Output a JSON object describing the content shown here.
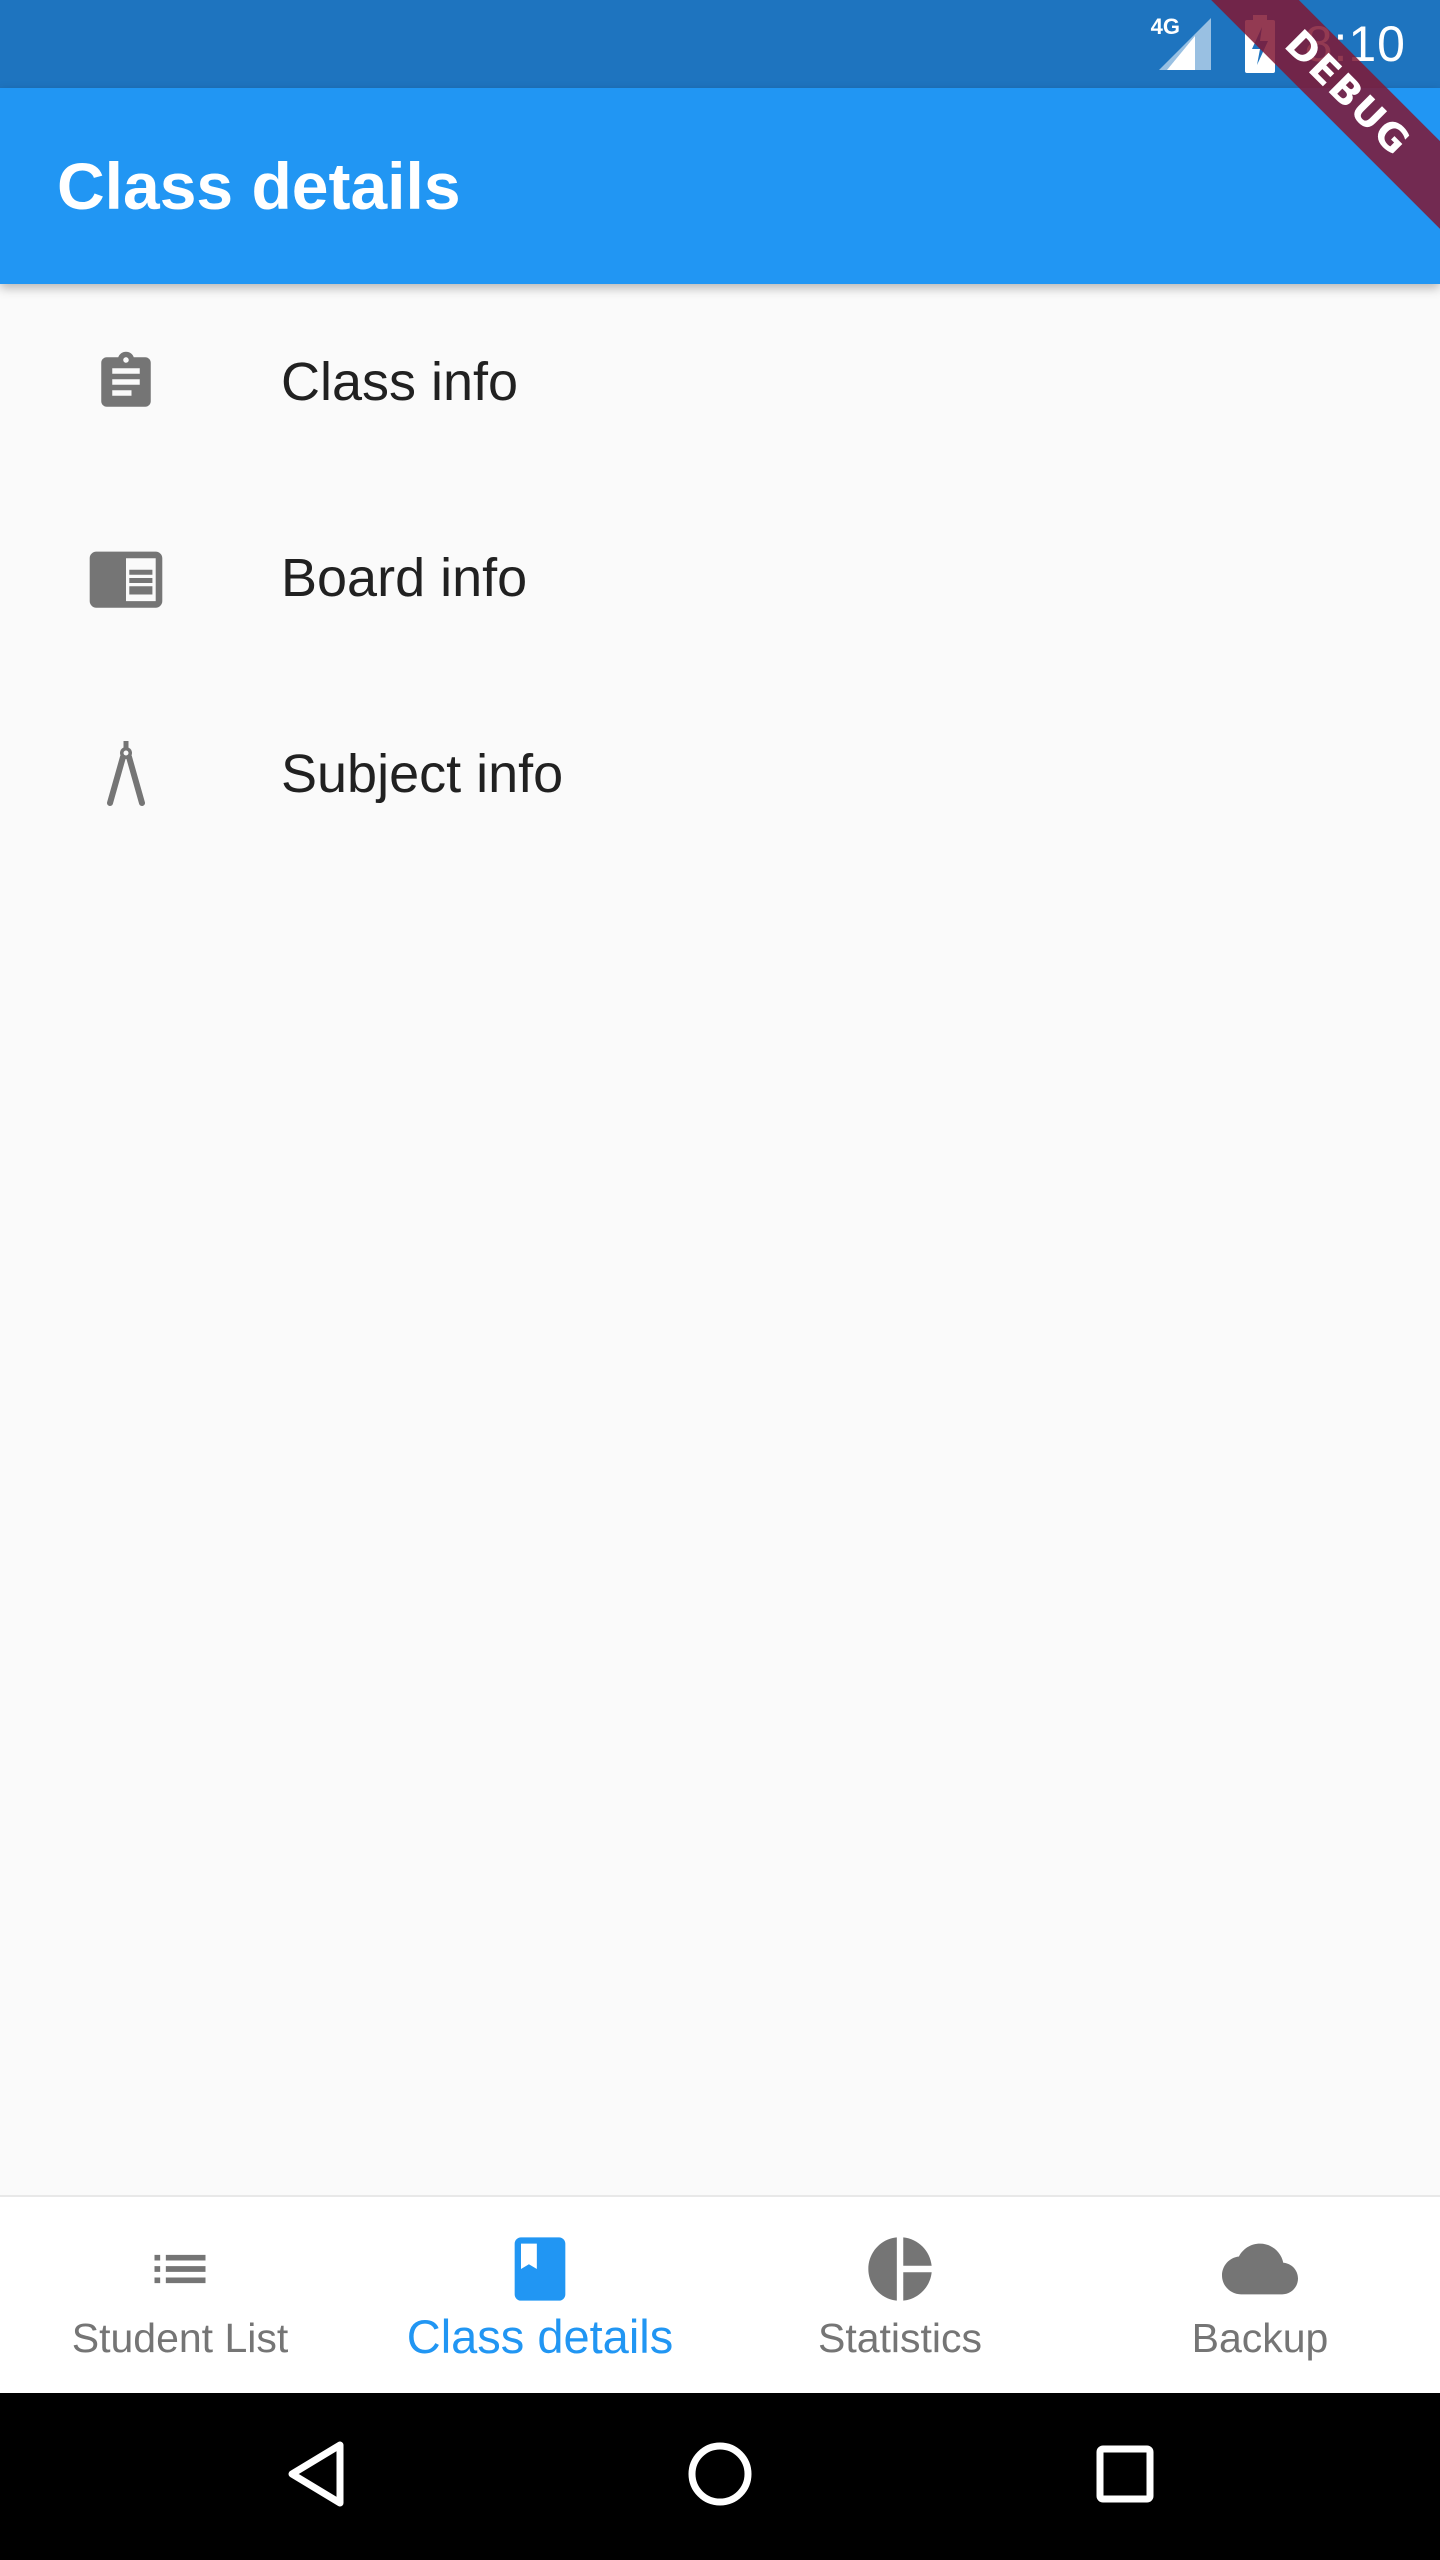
{
  "status_bar": {
    "time": "8:10",
    "network_label": "4G",
    "icons": [
      "signal-4g-icon",
      "battery-charging-icon"
    ]
  },
  "debug_banner": {
    "text": "DEBUG"
  },
  "app_bar": {
    "title": "Class details"
  },
  "list": {
    "items": [
      {
        "label": "Class info",
        "icon": "clipboard-icon"
      },
      {
        "label": "Board info",
        "icon": "chrome-reader-book-icon"
      },
      {
        "label": "Subject info",
        "icon": "compass-drawing-icon"
      }
    ]
  },
  "bottom_nav": {
    "items": [
      {
        "label": "Student List",
        "icon": "list-icon",
        "active": false
      },
      {
        "label": "Class details",
        "icon": "book-icon",
        "active": true
      },
      {
        "label": "Statistics",
        "icon": "pie-chart-icon",
        "active": false
      },
      {
        "label": "Backup",
        "icon": "cloud-icon",
        "active": false
      }
    ]
  },
  "system_nav": {
    "buttons": [
      "back-icon",
      "home-icon",
      "recents-icon"
    ]
  },
  "colors": {
    "primary": "#2196f3",
    "status_bar": "#1e74bf",
    "background": "#fafafa",
    "icon_grey": "#757575",
    "text_dark": "#212121",
    "debug": "#801834"
  }
}
